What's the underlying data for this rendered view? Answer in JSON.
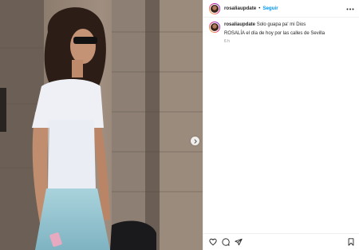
{
  "post": {
    "username": "rosaliaupdate",
    "follow_label": "Seguir",
    "separator": "•",
    "caption_text": "Solo guapa pa' mi Dios",
    "caption_body": "ROSALÍA el día de hoy por las calles de Sevilla",
    "time": "6 h",
    "image_alt": "Woman with curly hair and sunglasses wearing a white t-shirt and light blue skirt on a street"
  },
  "icons": {
    "more": "more-horizontal-icon",
    "next": "chevron-right-icon",
    "like": "heart-icon",
    "comment": "comment-icon",
    "share": "send-icon",
    "save": "bookmark-icon"
  },
  "colors": {
    "follow": "#0095f6",
    "text": "#262626",
    "muted": "#8e8e8e"
  }
}
